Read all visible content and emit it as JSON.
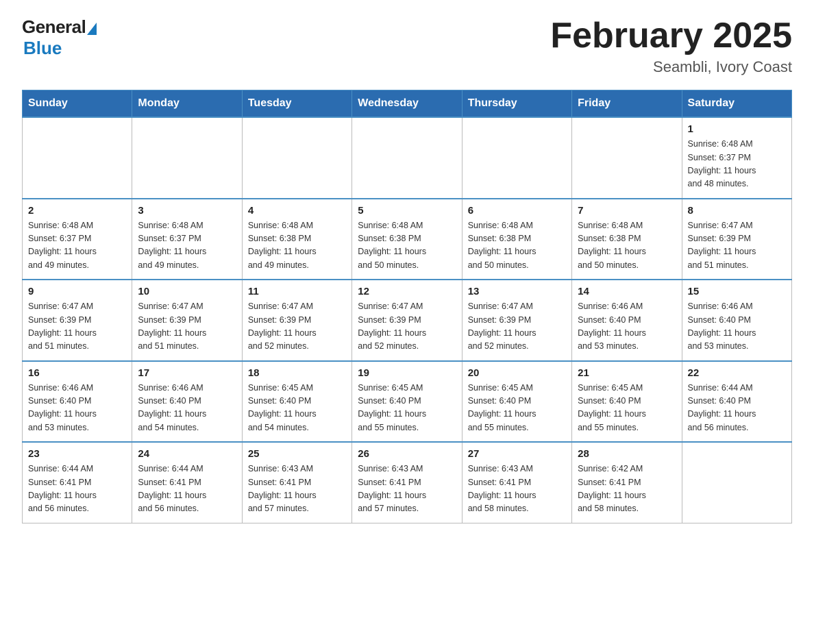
{
  "header": {
    "logo_general": "General",
    "logo_blue": "Blue",
    "month_title": "February 2025",
    "location": "Seambli, Ivory Coast"
  },
  "weekdays": [
    "Sunday",
    "Monday",
    "Tuesday",
    "Wednesday",
    "Thursday",
    "Friday",
    "Saturday"
  ],
  "weeks": [
    [
      {
        "day": "",
        "info": ""
      },
      {
        "day": "",
        "info": ""
      },
      {
        "day": "",
        "info": ""
      },
      {
        "day": "",
        "info": ""
      },
      {
        "day": "",
        "info": ""
      },
      {
        "day": "",
        "info": ""
      },
      {
        "day": "1",
        "info": "Sunrise: 6:48 AM\nSunset: 6:37 PM\nDaylight: 11 hours\nand 48 minutes."
      }
    ],
    [
      {
        "day": "2",
        "info": "Sunrise: 6:48 AM\nSunset: 6:37 PM\nDaylight: 11 hours\nand 49 minutes."
      },
      {
        "day": "3",
        "info": "Sunrise: 6:48 AM\nSunset: 6:37 PM\nDaylight: 11 hours\nand 49 minutes."
      },
      {
        "day": "4",
        "info": "Sunrise: 6:48 AM\nSunset: 6:38 PM\nDaylight: 11 hours\nand 49 minutes."
      },
      {
        "day": "5",
        "info": "Sunrise: 6:48 AM\nSunset: 6:38 PM\nDaylight: 11 hours\nand 50 minutes."
      },
      {
        "day": "6",
        "info": "Sunrise: 6:48 AM\nSunset: 6:38 PM\nDaylight: 11 hours\nand 50 minutes."
      },
      {
        "day": "7",
        "info": "Sunrise: 6:48 AM\nSunset: 6:38 PM\nDaylight: 11 hours\nand 50 minutes."
      },
      {
        "day": "8",
        "info": "Sunrise: 6:47 AM\nSunset: 6:39 PM\nDaylight: 11 hours\nand 51 minutes."
      }
    ],
    [
      {
        "day": "9",
        "info": "Sunrise: 6:47 AM\nSunset: 6:39 PM\nDaylight: 11 hours\nand 51 minutes."
      },
      {
        "day": "10",
        "info": "Sunrise: 6:47 AM\nSunset: 6:39 PM\nDaylight: 11 hours\nand 51 minutes."
      },
      {
        "day": "11",
        "info": "Sunrise: 6:47 AM\nSunset: 6:39 PM\nDaylight: 11 hours\nand 52 minutes."
      },
      {
        "day": "12",
        "info": "Sunrise: 6:47 AM\nSunset: 6:39 PM\nDaylight: 11 hours\nand 52 minutes."
      },
      {
        "day": "13",
        "info": "Sunrise: 6:47 AM\nSunset: 6:39 PM\nDaylight: 11 hours\nand 52 minutes."
      },
      {
        "day": "14",
        "info": "Sunrise: 6:46 AM\nSunset: 6:40 PM\nDaylight: 11 hours\nand 53 minutes."
      },
      {
        "day": "15",
        "info": "Sunrise: 6:46 AM\nSunset: 6:40 PM\nDaylight: 11 hours\nand 53 minutes."
      }
    ],
    [
      {
        "day": "16",
        "info": "Sunrise: 6:46 AM\nSunset: 6:40 PM\nDaylight: 11 hours\nand 53 minutes."
      },
      {
        "day": "17",
        "info": "Sunrise: 6:46 AM\nSunset: 6:40 PM\nDaylight: 11 hours\nand 54 minutes."
      },
      {
        "day": "18",
        "info": "Sunrise: 6:45 AM\nSunset: 6:40 PM\nDaylight: 11 hours\nand 54 minutes."
      },
      {
        "day": "19",
        "info": "Sunrise: 6:45 AM\nSunset: 6:40 PM\nDaylight: 11 hours\nand 55 minutes."
      },
      {
        "day": "20",
        "info": "Sunrise: 6:45 AM\nSunset: 6:40 PM\nDaylight: 11 hours\nand 55 minutes."
      },
      {
        "day": "21",
        "info": "Sunrise: 6:45 AM\nSunset: 6:40 PM\nDaylight: 11 hours\nand 55 minutes."
      },
      {
        "day": "22",
        "info": "Sunrise: 6:44 AM\nSunset: 6:40 PM\nDaylight: 11 hours\nand 56 minutes."
      }
    ],
    [
      {
        "day": "23",
        "info": "Sunrise: 6:44 AM\nSunset: 6:41 PM\nDaylight: 11 hours\nand 56 minutes."
      },
      {
        "day": "24",
        "info": "Sunrise: 6:44 AM\nSunset: 6:41 PM\nDaylight: 11 hours\nand 56 minutes."
      },
      {
        "day": "25",
        "info": "Sunrise: 6:43 AM\nSunset: 6:41 PM\nDaylight: 11 hours\nand 57 minutes."
      },
      {
        "day": "26",
        "info": "Sunrise: 6:43 AM\nSunset: 6:41 PM\nDaylight: 11 hours\nand 57 minutes."
      },
      {
        "day": "27",
        "info": "Sunrise: 6:43 AM\nSunset: 6:41 PM\nDaylight: 11 hours\nand 58 minutes."
      },
      {
        "day": "28",
        "info": "Sunrise: 6:42 AM\nSunset: 6:41 PM\nDaylight: 11 hours\nand 58 minutes."
      },
      {
        "day": "",
        "info": ""
      }
    ]
  ]
}
